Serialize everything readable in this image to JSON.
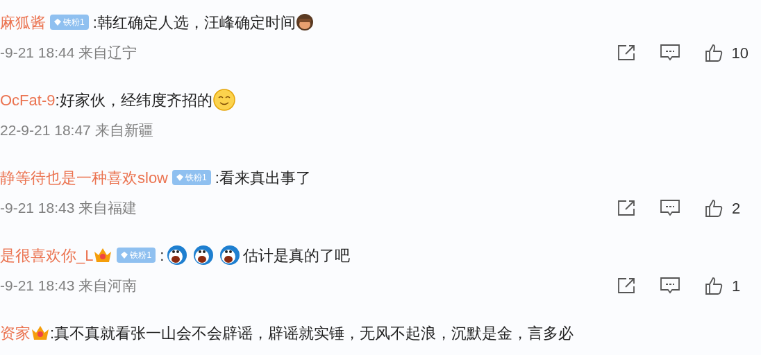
{
  "comments": [
    {
      "name": "麻狐酱",
      "badge": "铁粉1",
      "segments": [
        {
          "kind": "text",
          "text": ":韩红确定人选，汪峰确定时间"
        },
        {
          "kind": "monkey"
        }
      ],
      "meta": "-9-21 18:44 来自辽宁",
      "likes": "10"
    },
    {
      "name": "OcFat-9",
      "segments": [
        {
          "kind": "text",
          "text": ":好家伙，经纬度齐招的"
        },
        {
          "kind": "smile"
        }
      ],
      "meta": "22-9-21 18:47 来自新疆"
    },
    {
      "name": "静等待也是一种喜欢slow",
      "badge": "铁粉1",
      "segments": [
        {
          "kind": "text",
          "text": ":看来真出事了"
        }
      ],
      "meta": "-9-21 18:43 来自福建",
      "likes": "2"
    },
    {
      "name": "是很喜欢你_L",
      "crown": true,
      "badge": "铁粉1",
      "segments": [
        {
          "kind": "text",
          "text": ":"
        },
        {
          "kind": "cat"
        },
        {
          "kind": "cat"
        },
        {
          "kind": "cat"
        },
        {
          "kind": "text",
          "text": "估计是真的了吧"
        }
      ],
      "meta": "-9-21 18:43 来自河南",
      "likes": "1"
    },
    {
      "name": "资家",
      "crown": true,
      "segments": [
        {
          "kind": "text",
          "text": ":真不真就看张一山会不会辟谣，辟谣就实锤，无风不起浪，沉默是金，言多必"
        }
      ]
    }
  ]
}
